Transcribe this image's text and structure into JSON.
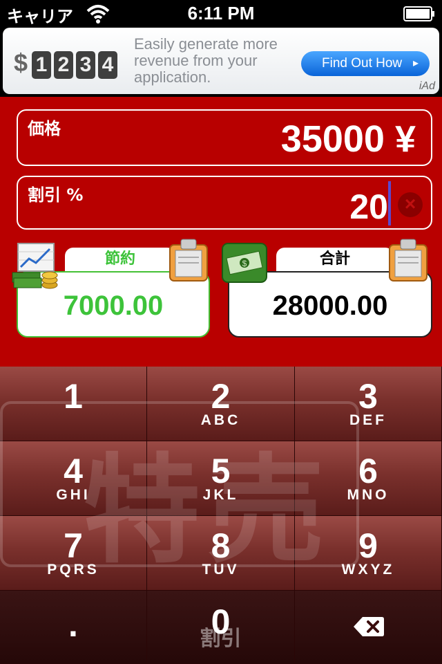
{
  "status_bar": {
    "carrier": "キャリア",
    "time": "6:11 PM"
  },
  "ad": {
    "dollar": "$",
    "digits": [
      "1",
      "2",
      "3",
      "4"
    ],
    "text": "Easily generate more revenue from your application.",
    "button": "Find Out How",
    "button_arrow": "▸",
    "logo": "iAd"
  },
  "price": {
    "label": "価格",
    "value": "35000 ¥"
  },
  "discount": {
    "label": "割引 %",
    "value": "20",
    "clear": "×"
  },
  "savings": {
    "label": "節約",
    "value": "7000.00"
  },
  "total": {
    "label": "合計",
    "value": "28000.00"
  },
  "keypad": {
    "watermark": "特売",
    "keys": [
      {
        "num": "1",
        "sub": ""
      },
      {
        "num": "2",
        "sub": "ABC"
      },
      {
        "num": "3",
        "sub": "DEF"
      },
      {
        "num": "4",
        "sub": "GHI"
      },
      {
        "num": "5",
        "sub": "JKL"
      },
      {
        "num": "6",
        "sub": "MNO"
      },
      {
        "num": "7",
        "sub": "PQRS"
      },
      {
        "num": "8",
        "sub": "TUV"
      },
      {
        "num": "9",
        "sub": "WXYZ"
      }
    ],
    "dot": ".",
    "zero": "0",
    "zero_caption": "割引",
    "backspace_icon": "backspace-icon"
  },
  "colors": {
    "background_red": "#b90000",
    "savings_green": "#3dc33a",
    "ad_button_blue": "#1f7fe8"
  }
}
